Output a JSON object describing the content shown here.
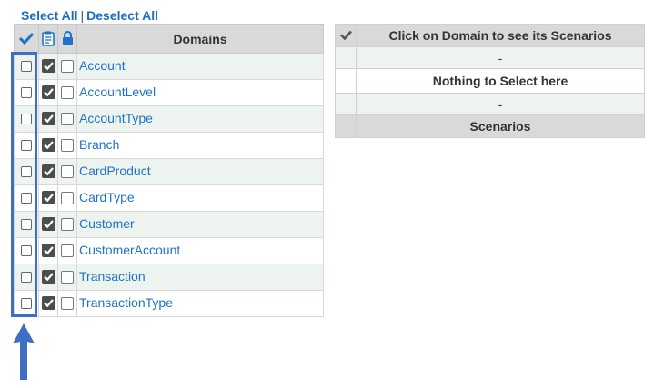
{
  "links": {
    "select_all": "Select All",
    "separator": "|",
    "deselect_all": "Deselect All"
  },
  "domains_table": {
    "header": "Domains",
    "rows": [
      {
        "name": "Account"
      },
      {
        "name": "AccountLevel"
      },
      {
        "name": "AccountType"
      },
      {
        "name": "Branch"
      },
      {
        "name": "CardProduct"
      },
      {
        "name": "CardType"
      },
      {
        "name": "Customer"
      },
      {
        "name": "CustomerAccount"
      },
      {
        "name": "Transaction"
      },
      {
        "name": "TransactionType"
      }
    ]
  },
  "scenarios_panel": {
    "header": "Click on Domain to see its Scenarios",
    "dash1": "-",
    "message": "Nothing to Select here",
    "dash2": "-",
    "footer": "Scenarios"
  },
  "colors": {
    "link": "#1e73c8",
    "highlight": "#3e6fc2",
    "header_bg": "#d9d9d9",
    "alt_row": "#edf3ee"
  },
  "icons": {
    "select_col": "checkmark-icon",
    "clipboard_col": "clipboard-icon",
    "lock_col": "lock-icon",
    "annotation": "up-arrow-icon"
  }
}
